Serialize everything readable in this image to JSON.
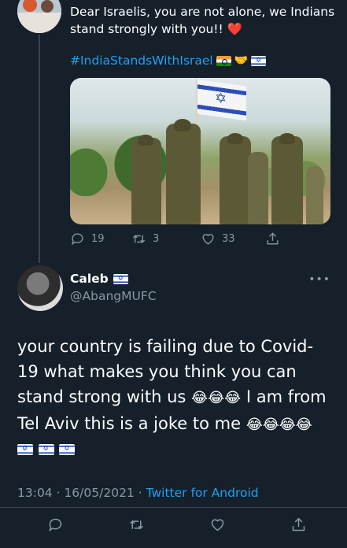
{
  "parent_tweet": {
    "text": "Dear Israelis, you are not alone, we Indians stand strongly with you!!",
    "heart_emoji": "❤️",
    "hashtag": "#IndiaStandsWithIsrael",
    "image_icon": "soldiers-with-flag-photo",
    "stats": {
      "replies": "19",
      "retweets": "3",
      "likes": "33"
    }
  },
  "quote_tweet": {
    "display_name": "Caleb",
    "handle": "@AbangMUFC",
    "text_part1": "your country is failing due to Covid-19 what makes you think you can stand strong with us",
    "laugh_emoji_1": "😂😂😂",
    "text_part2": "I am from Tel Aviv this is a joke to me",
    "laugh_emoji_2": "😂😂😂😂",
    "date": "13:04 · 16/05/2021 · ",
    "client": "Twitter for Android"
  },
  "colors": {
    "background": "#15202b",
    "accent": "#1da1f2",
    "muted": "#8899a6",
    "divider": "#38444d"
  }
}
